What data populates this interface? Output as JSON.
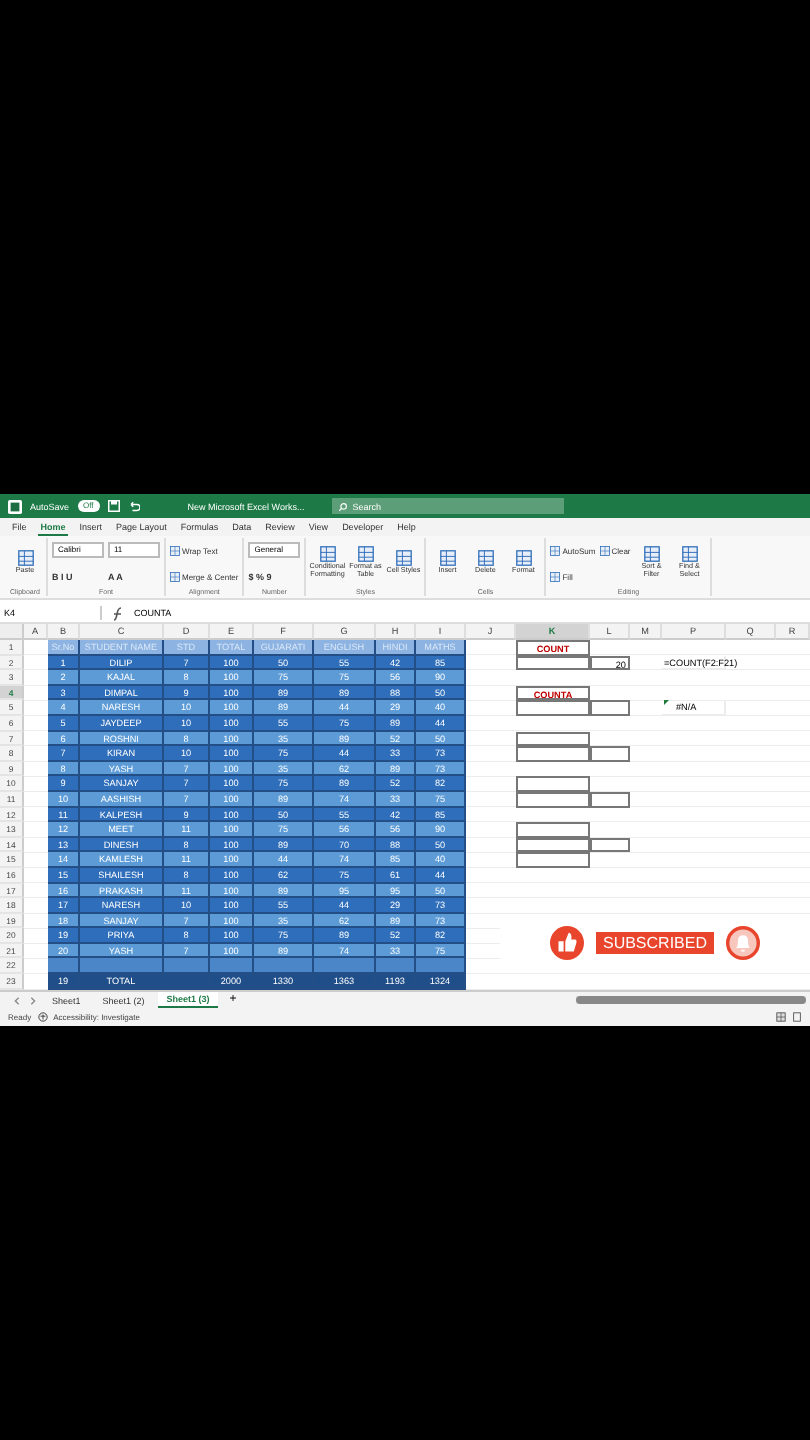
{
  "title_bar": {
    "autosave_label": "AutoSave",
    "autosave_state": "Off",
    "autosave_on": false,
    "document_title": "New Microsoft Excel Works...",
    "search": {
      "placeholder": "Search"
    }
  },
  "menu_tabs": [
    {
      "label": "File",
      "selected": false
    },
    {
      "label": "Home",
      "selected": true
    },
    {
      "label": "Insert",
      "selected": false
    },
    {
      "label": "Page Layout",
      "selected": false
    },
    {
      "label": "Formulas",
      "selected": false
    },
    {
      "label": "Data",
      "selected": false
    },
    {
      "label": "Review",
      "selected": false
    },
    {
      "label": "View",
      "selected": false
    },
    {
      "label": "Developer",
      "selected": false
    },
    {
      "label": "Help",
      "selected": false
    }
  ],
  "ribbon_groups": [
    {
      "label": "Clipboard",
      "items": [
        {
          "kind": "big",
          "label": "Paste"
        }
      ]
    },
    {
      "label": "Font",
      "items": [
        {
          "kind": "field",
          "label": "Calibri"
        },
        {
          "kind": "field",
          "label": "11"
        },
        {
          "kind": "letters",
          "label": "B I U"
        },
        {
          "kind": "letters",
          "label": "A A"
        }
      ]
    },
    {
      "label": "Alignment",
      "items": [
        {
          "kind": "small",
          "label": "Wrap Text"
        },
        {
          "kind": "small",
          "label": "Merge & Center"
        }
      ]
    },
    {
      "label": "Number",
      "items": [
        {
          "kind": "field",
          "label": "General"
        },
        {
          "kind": "letters",
          "label": "$ % 9"
        }
      ]
    },
    {
      "label": "Styles",
      "items": [
        {
          "kind": "big",
          "label": "Conditional Formatting"
        },
        {
          "kind": "big",
          "label": "Format as Table"
        },
        {
          "kind": "big",
          "label": "Cell Styles"
        }
      ]
    },
    {
      "label": "Cells",
      "items": [
        {
          "kind": "big",
          "label": "Insert"
        },
        {
          "kind": "big",
          "label": "Delete"
        },
        {
          "kind": "big",
          "label": "Format"
        }
      ]
    },
    {
      "label": "Editing",
      "items": [
        {
          "kind": "small",
          "label": "AutoSum"
        },
        {
          "kind": "small",
          "label": "Fill"
        },
        {
          "kind": "small",
          "label": "Clear"
        },
        {
          "kind": "big",
          "label": "Sort & Filter"
        },
        {
          "kind": "big",
          "label": "Find & Select"
        }
      ]
    }
  ],
  "formula_bar": {
    "name_box": "K4",
    "formula": "COUNTA"
  },
  "columns": [
    {
      "letter": "A",
      "selected": false
    },
    {
      "letter": "B",
      "selected": false
    },
    {
      "letter": "C",
      "selected": false
    },
    {
      "letter": "D",
      "selected": false
    },
    {
      "letter": "E",
      "selected": false
    },
    {
      "letter": "F",
      "selected": false
    },
    {
      "letter": "G",
      "selected": false
    },
    {
      "letter": "H",
      "selected": false
    },
    {
      "letter": "I",
      "selected": false
    },
    {
      "letter": "J",
      "selected": false
    },
    {
      "letter": "K",
      "selected": true
    },
    {
      "letter": "L",
      "selected": false
    },
    {
      "letter": "M",
      "selected": false
    },
    {
      "letter": "P",
      "selected": false
    },
    {
      "letter": "Q",
      "selected": false
    },
    {
      "letter": "R",
      "selected": false
    }
  ],
  "rows": [
    {
      "number": "1",
      "selected": false,
      "kind": "header",
      "values": [
        "Sr.No",
        "STUDENT NAME",
        "STD",
        "TOTAL",
        "GUJARATI",
        "ENGLISH",
        "HINDI",
        "MATHS"
      ],
      "k": {
        "text": "COUNT",
        "kind": "label",
        "boxed": true
      }
    },
    {
      "number": "2",
      "selected": false,
      "kind": "data",
      "values": [
        "1",
        "DILIP",
        "7",
        "100",
        "50",
        "55",
        "42",
        "85"
      ],
      "k": {
        "boxed": true
      },
      "l": {
        "text": "20",
        "kind": "number",
        "boxed": true
      },
      "p": {
        "text": "=COUNT(F2:F21)",
        "kind": "formula"
      }
    },
    {
      "number": "3",
      "selected": false,
      "kind": "data",
      "values": [
        "2",
        "KAJAL",
        "8",
        "100",
        "75",
        "75",
        "56",
        "90"
      ]
    },
    {
      "number": "4",
      "selected": true,
      "kind": "data",
      "values": [
        "3",
        "DIMPAL",
        "9",
        "100",
        "89",
        "89",
        "88",
        "50"
      ],
      "k": {
        "text": "COUNTA",
        "kind": "label",
        "boxed": true
      }
    },
    {
      "number": "5",
      "selected": false,
      "kind": "data",
      "values": [
        "4",
        "NARESH",
        "10",
        "100",
        "89",
        "44",
        "29",
        "40"
      ],
      "k": {
        "boxed": true
      },
      "l": {
        "boxed": true
      },
      "p": {
        "text": "#N/A",
        "kind": "error"
      }
    },
    {
      "number": "6",
      "selected": false,
      "kind": "data",
      "values": [
        "5",
        "JAYDEEP",
        "10",
        "100",
        "55",
        "75",
        "89",
        "44"
      ]
    },
    {
      "number": "7",
      "selected": false,
      "kind": "data",
      "values": [
        "6",
        "ROSHNI",
        "8",
        "100",
        "35",
        "89",
        "52",
        "50"
      ],
      "k": {
        "boxed": true
      }
    },
    {
      "number": "8",
      "selected": false,
      "kind": "data",
      "values": [
        "7",
        "KIRAN",
        "10",
        "100",
        "75",
        "44",
        "33",
        "73"
      ],
      "k": {
        "boxed": true
      },
      "l": {
        "boxed": true
      }
    },
    {
      "number": "9",
      "selected": false,
      "kind": "data",
      "values": [
        "8",
        "YASH",
        "7",
        "100",
        "35",
        "62",
        "89",
        "73"
      ]
    },
    {
      "number": "10",
      "selected": false,
      "kind": "data",
      "values": [
        "9",
        "SANJAY",
        "7",
        "100",
        "75",
        "89",
        "52",
        "82"
      ],
      "k": {
        "boxed": true
      }
    },
    {
      "number": "11",
      "selected": false,
      "kind": "data",
      "values": [
        "10",
        "AASHISH",
        "7",
        "100",
        "89",
        "74",
        "33",
        "75"
      ],
      "k": {
        "boxed": true
      },
      "l": {
        "boxed": true
      }
    },
    {
      "number": "12",
      "selected": false,
      "kind": "data",
      "values": [
        "11",
        "KALPESH",
        "9",
        "100",
        "50",
        "55",
        "42",
        "85"
      ]
    },
    {
      "number": "13",
      "selected": false,
      "kind": "data",
      "values": [
        "12",
        "MEET",
        "11",
        "100",
        "75",
        "56",
        "56",
        "90"
      ],
      "k": {
        "boxed": true
      }
    },
    {
      "number": "14",
      "selected": false,
      "kind": "data",
      "values": [
        "13",
        "DINESH",
        "8",
        "100",
        "89",
        "70",
        "88",
        "50"
      ],
      "k": {
        "boxed": true
      },
      "l": {
        "boxed": true
      }
    },
    {
      "number": "15",
      "selected": false,
      "kind": "data",
      "values": [
        "14",
        "KAMLESH",
        "11",
        "100",
        "44",
        "74",
        "85",
        "40"
      ],
      "k": {
        "boxed": true
      }
    },
    {
      "number": "16",
      "selected": false,
      "kind": "data",
      "values": [
        "15",
        "SHAILESH",
        "8",
        "100",
        "62",
        "75",
        "61",
        "44"
      ]
    },
    {
      "number": "17",
      "selected": false,
      "kind": "data",
      "values": [
        "16",
        "PRAKASH",
        "11",
        "100",
        "89",
        "95",
        "95",
        "50"
      ]
    },
    {
      "number": "18",
      "selected": false,
      "kind": "data",
      "values": [
        "17",
        "NARESH",
        "10",
        "100",
        "55",
        "44",
        "29",
        "73"
      ]
    },
    {
      "number": "19",
      "selected": false,
      "kind": "data",
      "values": [
        "18",
        "SANJAY",
        "7",
        "100",
        "35",
        "62",
        "89",
        "73"
      ]
    },
    {
      "number": "20",
      "selected": false,
      "kind": "data",
      "values": [
        "19",
        "PRIYA",
        "8",
        "100",
        "75",
        "89",
        "52",
        "82"
      ]
    },
    {
      "number": "21",
      "selected": false,
      "kind": "data",
      "values": [
        "20",
        "YASH",
        "7",
        "100",
        "89",
        "74",
        "33",
        "75"
      ]
    },
    {
      "number": "22",
      "selected": false,
      "kind": "blank"
    },
    {
      "number": "23",
      "selected": false,
      "kind": "total",
      "values": [
        "19",
        "TOTAL"
      ],
      "sums": [
        "2000",
        "1330",
        "1363",
        "1193",
        "1324"
      ]
    }
  ],
  "overlay": {
    "label": "SUBSCRIBED"
  },
  "sheet_tabs": [
    {
      "label": "Sheet1",
      "selected": false
    },
    {
      "label": "Sheet1 (2)",
      "selected": false
    },
    {
      "label": "Sheet1 (3)",
      "selected": true
    }
  ],
  "add_sheet": "+",
  "status_bar": {
    "mode": "Ready",
    "accessibility": "Accessibility: Investigate"
  }
}
